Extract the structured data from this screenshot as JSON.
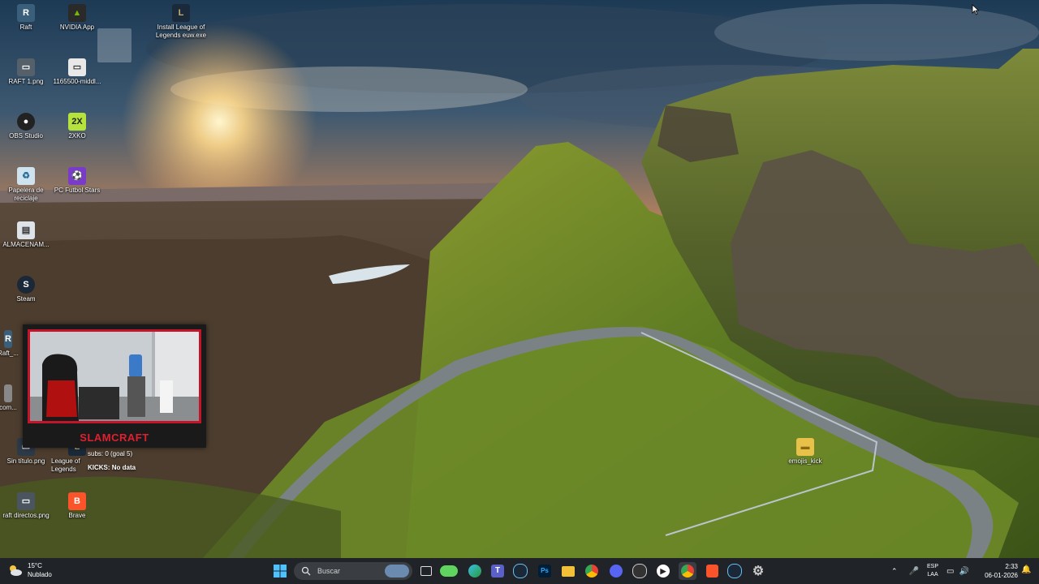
{
  "desktop_icons": [
    {
      "label": "Raft",
      "icon": "raft-icon"
    },
    {
      "label": "NVIDIA App",
      "icon": "nvidia-icon"
    },
    {
      "label": "Install League of Legends euw.exe",
      "icon": "league-installer-icon"
    },
    {
      "label": "RAFT 1.png",
      "icon": "image-file-icon"
    },
    {
      "label": "1165500-middl...",
      "icon": "image-file-icon"
    },
    {
      "label": "OBS Studio",
      "icon": "obs-icon"
    },
    {
      "label": "2XKO",
      "icon": "2xko-icon"
    },
    {
      "label": "Papelera de reciclaje",
      "icon": "recycle-bin-icon"
    },
    {
      "label": "PC Futbol Stars",
      "icon": "pc-futbol-icon"
    },
    {
      "label": "ALMACENAM...",
      "icon": "storage-icon"
    },
    {
      "label": "Steam",
      "icon": "steam-icon"
    },
    {
      "label": "Raft_...",
      "icon": "raft-icon"
    },
    {
      "label": "com...",
      "icon": "file-icon"
    },
    {
      "label": "Sin título.png",
      "icon": "image-file-icon"
    },
    {
      "label": "League of Legends",
      "icon": "league-icon"
    },
    {
      "label": "emojis_kick",
      "icon": "folder-icon"
    },
    {
      "label": "raft directos.png",
      "icon": "image-file-icon"
    },
    {
      "label": "Brave",
      "icon": "brave-icon"
    }
  ],
  "webcam_overlay": {
    "streamer_name": "SLAMCRAFT",
    "subs_text": "subs: 0 (goal 5)",
    "kicks_text": "KICKS: No data"
  },
  "taskbar": {
    "weather": {
      "temp": "15°C",
      "condition": "Nublado"
    },
    "search_placeholder": "Buscar",
    "pinned_apps": [
      "start-icon",
      "widget-icon",
      "file-window-icon",
      "game-bar-icon",
      "edge-icon",
      "teams-icon",
      "steam-icon",
      "photoshop-icon",
      "file-explorer-icon",
      "chrome-icon",
      "discord-icon",
      "obs-icon",
      "media-player-icon",
      "chrome-icon",
      "brave-icon",
      "steam-icon",
      "settings-icon"
    ],
    "tray": {
      "language": "ESP",
      "layout": "LAA"
    },
    "clock": {
      "time": "2:33",
      "date": "06-01-2026"
    }
  }
}
